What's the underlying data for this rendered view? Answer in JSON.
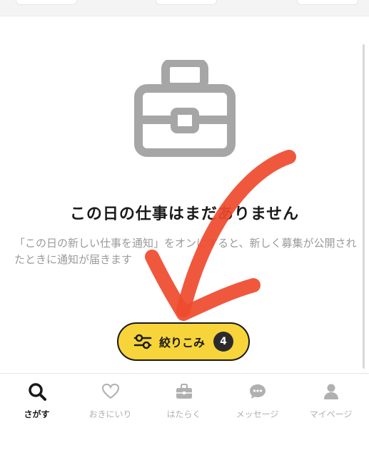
{
  "empty_state": {
    "title": "この日の仕事はまだありません",
    "description": "「この日の新しい仕事を通知」をオンにすると、新しく募集が公開されたときに通知が届きます",
    "icon": "briefcase-icon"
  },
  "filter": {
    "label": "絞りこみ",
    "count": "4",
    "icon": "filter-sliders-icon",
    "color": "#f7d43a"
  },
  "bottom_nav": {
    "items": [
      {
        "label": "さがす",
        "icon": "search-icon",
        "active": true
      },
      {
        "label": "おきにいり",
        "icon": "heart-icon",
        "active": false
      },
      {
        "label": "はたらく",
        "icon": "briefcase-icon",
        "active": false
      },
      {
        "label": "メッセージ",
        "icon": "chat-bubble-icon",
        "active": false
      },
      {
        "label": "マイページ",
        "icon": "person-icon",
        "active": false
      }
    ]
  },
  "annotation": {
    "color": "#ef4a2e",
    "shape": "hand-drawn-arrow"
  }
}
